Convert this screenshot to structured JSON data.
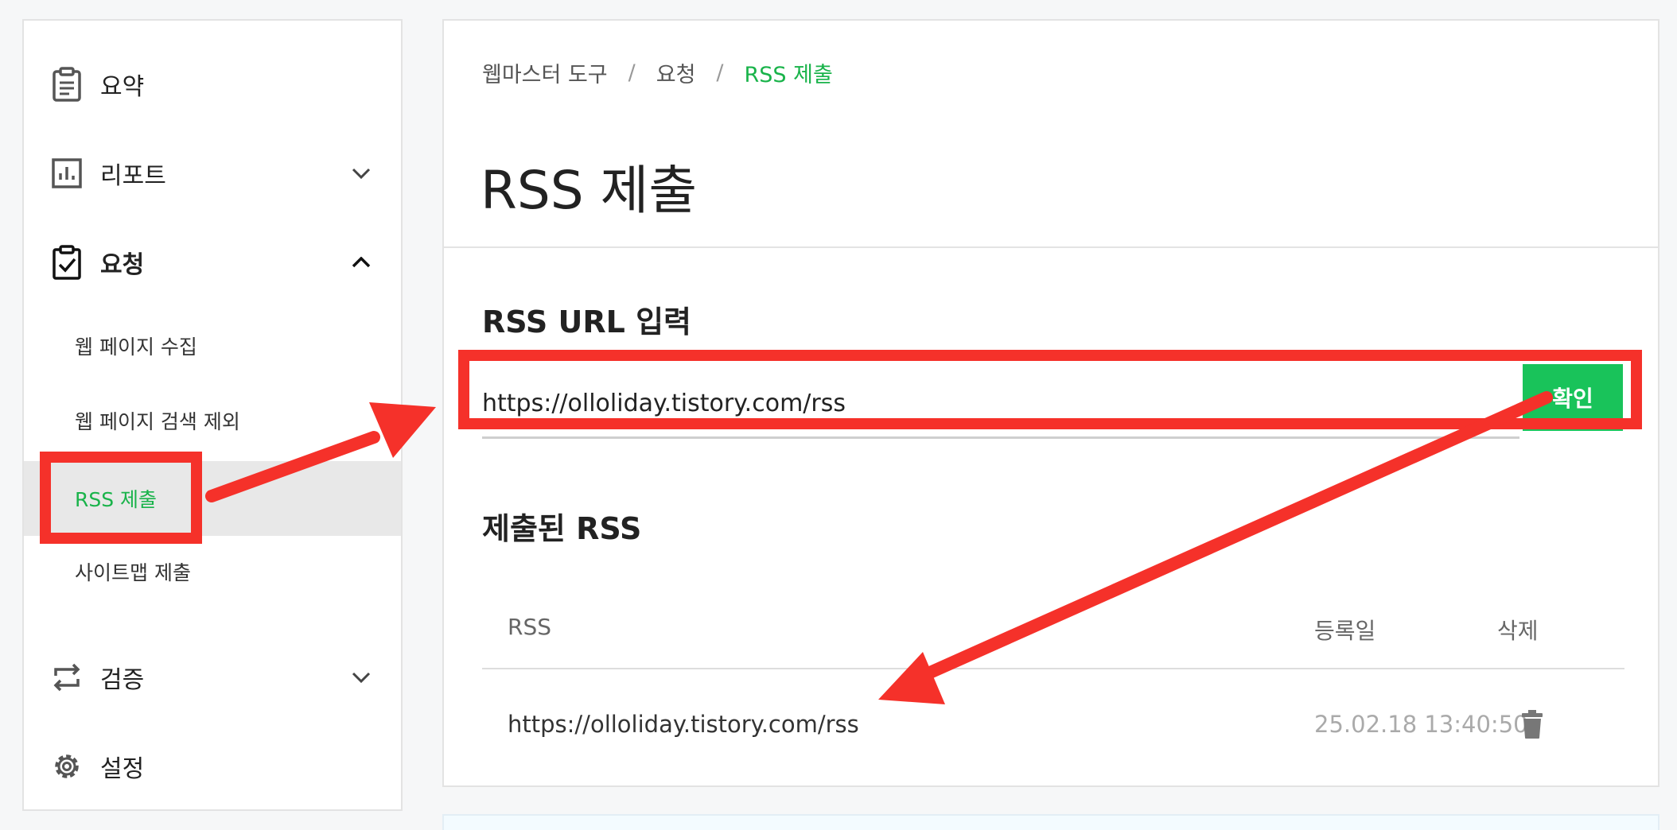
{
  "sidebar": {
    "items": [
      {
        "label": "요약",
        "icon": "clipboard-list-icon"
      },
      {
        "label": "리포트",
        "icon": "bar-chart-icon"
      },
      {
        "label": "요청",
        "icon": "clipboard-check-icon"
      },
      {
        "label": "검증",
        "icon": "repeat-icon"
      },
      {
        "label": "설정",
        "icon": "gear-icon"
      }
    ],
    "subitems": [
      {
        "label": "웹 페이지 수집"
      },
      {
        "label": "웹 페이지 검색 제외"
      },
      {
        "label": "RSS 제출"
      },
      {
        "label": "사이트맵 제출"
      }
    ]
  },
  "breadcrumb": {
    "items": [
      "웹마스터 도구",
      "요청",
      "RSS 제출"
    ],
    "separator": "/"
  },
  "main": {
    "title": "RSS 제출",
    "input_section_title": "RSS URL 입력",
    "input_value": "https://olloliday.tistory.com/rss",
    "confirm_label": "확인",
    "submitted_title": "제출된 RSS",
    "table": {
      "headers": [
        "RSS",
        "등록일",
        "삭제"
      ],
      "rows": [
        {
          "url": "https://olloliday.tistory.com/rss",
          "date": "25.02.18 13:40:50",
          "delete_icon": "trash-icon"
        }
      ]
    }
  },
  "colors": {
    "accent_green": "#19b34a",
    "button_green": "#19c35a",
    "annotation_red": "#f5312a"
  }
}
